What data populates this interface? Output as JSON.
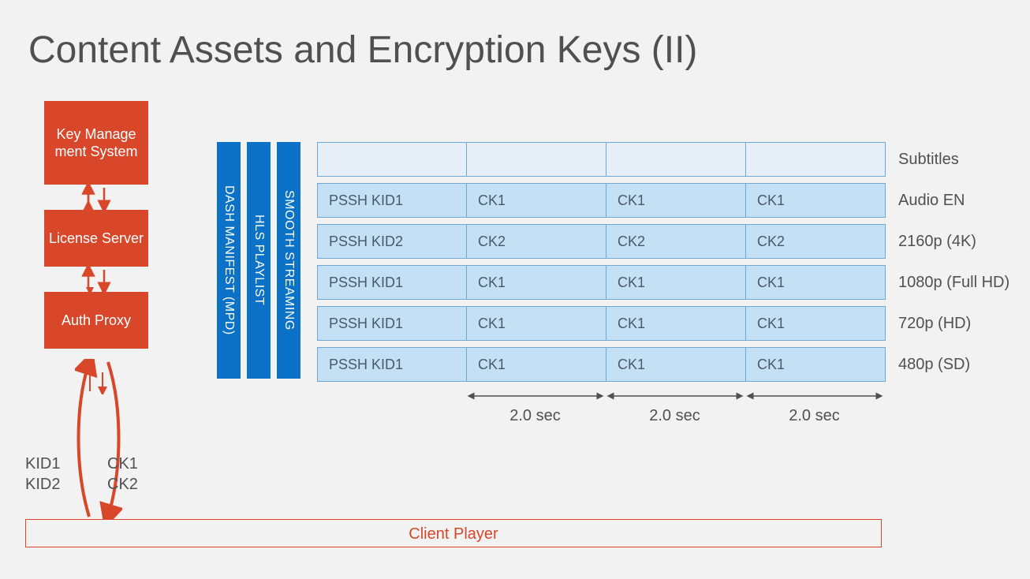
{
  "title": "Content Assets and Encryption Keys (II)",
  "left": {
    "kms": "Key Manage\nment System",
    "license": "License Server",
    "auth": "Auth Proxy",
    "kid_labels": "KID1\nKID2",
    "ck_labels": "CK1\nCK2"
  },
  "client": "Client Player",
  "manifests": [
    "DASH MANIFEST (MPD)",
    "HLS PLAYLIST",
    "SMOOTH STREAMING"
  ],
  "tracks": [
    {
      "label": "Subtitles",
      "first": "",
      "segs": [
        "",
        "",
        ""
      ],
      "style": "light"
    },
    {
      "label": "Audio EN",
      "first": "PSSH KID1",
      "segs": [
        "CK1",
        "CK1",
        "CK1"
      ],
      "style": "filled"
    },
    {
      "label": "2160p (4K)",
      "first": "PSSH KID2",
      "segs": [
        "CK2",
        "CK2",
        "CK2"
      ],
      "style": "filled"
    },
    {
      "label": "1080p (Full HD)",
      "first": "PSSH KID1",
      "segs": [
        "CK1",
        "CK1",
        "CK1"
      ],
      "style": "filled"
    },
    {
      "label": "720p (HD)",
      "first": "PSSH KID1",
      "segs": [
        "CK1",
        "CK1",
        "CK1"
      ],
      "style": "filled"
    },
    {
      "label": "480p (SD)",
      "first": "PSSH KID1",
      "segs": [
        "CK1",
        "CK1",
        "CK1"
      ],
      "style": "filled"
    }
  ],
  "segment_duration": "2.0 sec",
  "colors": {
    "red": "#d9472a",
    "blue": "#0c72c8",
    "cell": "#c3e0f4",
    "border": "#6ca7d8"
  }
}
